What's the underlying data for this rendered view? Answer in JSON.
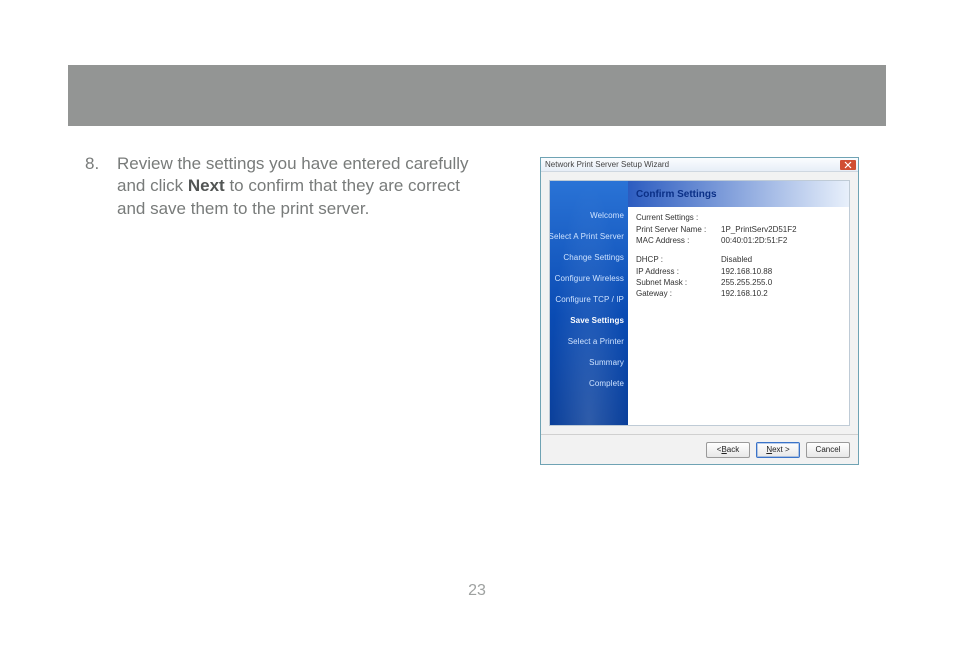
{
  "page_number": "23",
  "step": {
    "number": "8.",
    "text_before_bold": "Review the settings you have entered carefully and click ",
    "bold": "Next",
    "text_after_bold": " to confirm that they are correct and save them to the print server."
  },
  "wizard": {
    "title": "Network Print Server Setup Wizard",
    "close_icon_name": "close-icon",
    "sidebar": {
      "items": [
        {
          "label": "Welcome",
          "active": false
        },
        {
          "label": "Select A Print Server",
          "active": false
        },
        {
          "label": "Change Settings",
          "active": false
        },
        {
          "label": "Configure Wireless",
          "active": false
        },
        {
          "label": "Configure TCP / IP",
          "active": false
        },
        {
          "label": "Save Settings",
          "active": true
        },
        {
          "label": "Select a Printer",
          "active": false
        },
        {
          "label": "Summary",
          "active": false
        },
        {
          "label": "Complete",
          "active": false
        }
      ]
    },
    "content": {
      "heading": "Confirm Settings",
      "group_title": "Current Settings :",
      "rows1": [
        {
          "label": "Print Server Name :",
          "value": "1P_PrintServ2D51F2"
        },
        {
          "label": "MAC Address :",
          "value": "00:40:01:2D:51:F2"
        }
      ],
      "rows2": [
        {
          "label": "DHCP :",
          "value": "Disabled"
        },
        {
          "label": "IP Address :",
          "value": "192.168.10.88"
        },
        {
          "label": "Subnet Mask :",
          "value": "255.255.255.0"
        },
        {
          "label": "Gateway :",
          "value": "192.168.10.2"
        }
      ]
    },
    "footer": {
      "back": {
        "prefix": "< ",
        "hotkey": "B",
        "rest": "ack"
      },
      "next": {
        "hotkey": "N",
        "rest": "ext >"
      },
      "cancel": {
        "label": "Cancel"
      }
    }
  }
}
